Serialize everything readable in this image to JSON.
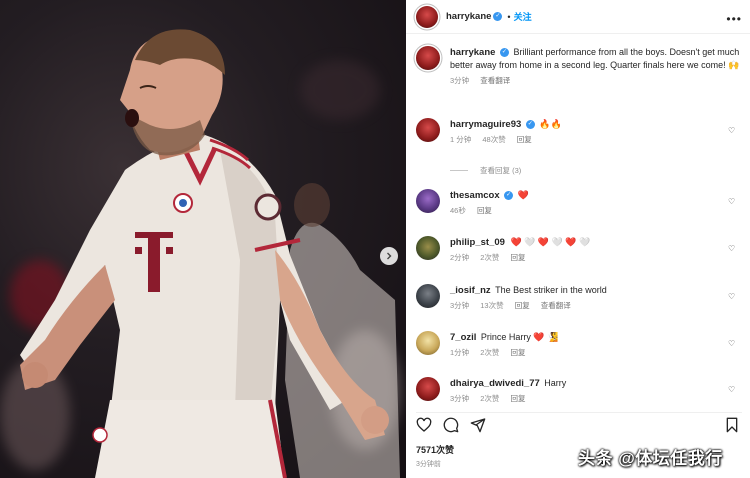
{
  "header": {
    "username": "harrykane",
    "follow_label": "关注",
    "more_icon": "more-horizontal-icon"
  },
  "caption": {
    "username": "harrykane",
    "text": "Brilliant performance from all the boys. Doesn't get much better away from home in a second leg. Quarter finals here we come! 🙌",
    "time": "3分钟",
    "translate": "查看翻译"
  },
  "comments": [
    {
      "username": "harrymaguire93",
      "text": "🔥🔥",
      "time": "1 分钟",
      "likes": "48次赞",
      "reply": "回复",
      "avatar_color": "#9b1c1c"
    },
    {
      "username": "thesamcox",
      "text": "❤️",
      "time": "46秒",
      "likes": "",
      "reply": "回复",
      "avatar_color": "#6a3f9c"
    },
    {
      "username": "philip_st_09",
      "text": "❤️ 🤍 ❤️ 🤍 ❤️ 🤍",
      "time": "2分钟",
      "likes": "2次赞",
      "reply": "回复",
      "avatar_color": "#4f5a2a"
    },
    {
      "username": "_iosif_nz",
      "text": "The Best striker in the world",
      "time": "3分钟",
      "likes": "13次赞",
      "reply": "回复",
      "translate": "查看翻译",
      "avatar_color": "#3e444b"
    },
    {
      "username": "7_ozil",
      "text": "Prince Harry ❤️ 🧏",
      "time": "1分钟",
      "likes": "2次赞",
      "reply": "回复",
      "avatar_color": "#c9a85a"
    },
    {
      "username": "dhairya_dwivedi_77",
      "text": "Harry",
      "time": "3分钟",
      "likes": "2次赞",
      "reply": "回复",
      "avatar_color": "#8c1b1b"
    }
  ],
  "view_replies": "查看回复 (3)",
  "actions": {
    "like_icon": "heart-icon",
    "comment_icon": "comment-icon",
    "share_icon": "send-icon",
    "save_icon": "bookmark-icon"
  },
  "likes_count": "7571次赞",
  "post_time": "3分钟前",
  "watermark": "头条 @体坛任我行",
  "colors": {
    "accent": "#0095f6",
    "verified": "#3897f0",
    "heart": "#ed4956"
  }
}
